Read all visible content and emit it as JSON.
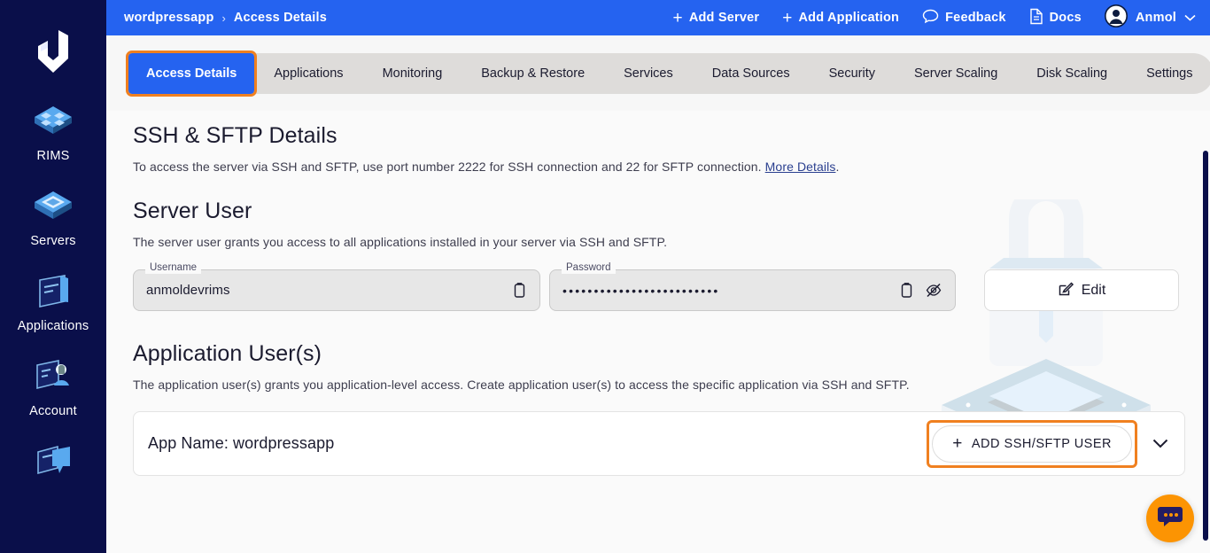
{
  "sidebar": {
    "logo_alt": "devrims-logo",
    "items": [
      {
        "label": "RIMS",
        "icon": "rims-stack-icon"
      },
      {
        "label": "Servers",
        "icon": "server-chip-icon"
      },
      {
        "label": "Applications",
        "icon": "applications-card-icon"
      },
      {
        "label": "Account",
        "icon": "account-user-icon"
      },
      {
        "label": "",
        "icon": "support-chat-icon"
      }
    ]
  },
  "topbar": {
    "breadcrumb": {
      "root": "wordpressapp",
      "separator": "›",
      "current": "Access Details"
    },
    "actions": [
      {
        "label": "Add Server",
        "icon": "plus-icon"
      },
      {
        "label": "Add Application",
        "icon": "plus-icon"
      },
      {
        "label": "Feedback",
        "icon": "chat-bubble-icon"
      },
      {
        "label": "Docs",
        "icon": "document-icon"
      }
    ],
    "user": {
      "name": "Anmol",
      "avatar": "avatar-icon",
      "chevron": "chevron-down-icon"
    }
  },
  "tabs": [
    {
      "label": "Access Details",
      "active": true
    },
    {
      "label": "Applications",
      "active": false
    },
    {
      "label": "Monitoring",
      "active": false
    },
    {
      "label": "Backup & Restore",
      "active": false
    },
    {
      "label": "Services",
      "active": false
    },
    {
      "label": "Data Sources",
      "active": false
    },
    {
      "label": "Security",
      "active": false
    },
    {
      "label": "Server Scaling",
      "active": false
    },
    {
      "label": "Disk Scaling",
      "active": false
    },
    {
      "label": "Settings",
      "active": false
    }
  ],
  "ssh_section": {
    "title": "SSH & SFTP Details",
    "desc_before": "To access the server via SSH and SFTP, use port number 2222 for SSH connection and 22 for SFTP connection. ",
    "desc_link": "More Details",
    "desc_after": "."
  },
  "server_user": {
    "title": "Server User",
    "desc": "The server user grants you access to all applications installed in your server via SSH and SFTP.",
    "username": {
      "label": "Username",
      "value": "anmoldevrims",
      "copy_icon": "copy-icon"
    },
    "password": {
      "label": "Password",
      "value": "•••••••••••••••••••••••••",
      "copy_icon": "copy-icon",
      "reveal_icon": "eye-off-icon"
    },
    "edit_button": {
      "label": "Edit",
      "icon": "edit-pencil-icon"
    }
  },
  "app_users": {
    "title": "Application User(s)",
    "desc": "The application user(s) grants you application-level access. Create application user(s) to access the specific application via SSH and SFTP.",
    "card": {
      "name": "App Name: wordpressapp",
      "add_button": {
        "label": "ADD SSH/SFTP USER",
        "icon": "plus-icon"
      },
      "expand_icon": "chevron-down-icon"
    }
  },
  "chat_widget": {
    "icon": "chat-dots-icon"
  },
  "colors": {
    "brand_blue": "#2563f0",
    "sidebar_navy": "#0a0f4a",
    "highlight_orange": "#f08020",
    "chat_orange": "#fc9403"
  }
}
